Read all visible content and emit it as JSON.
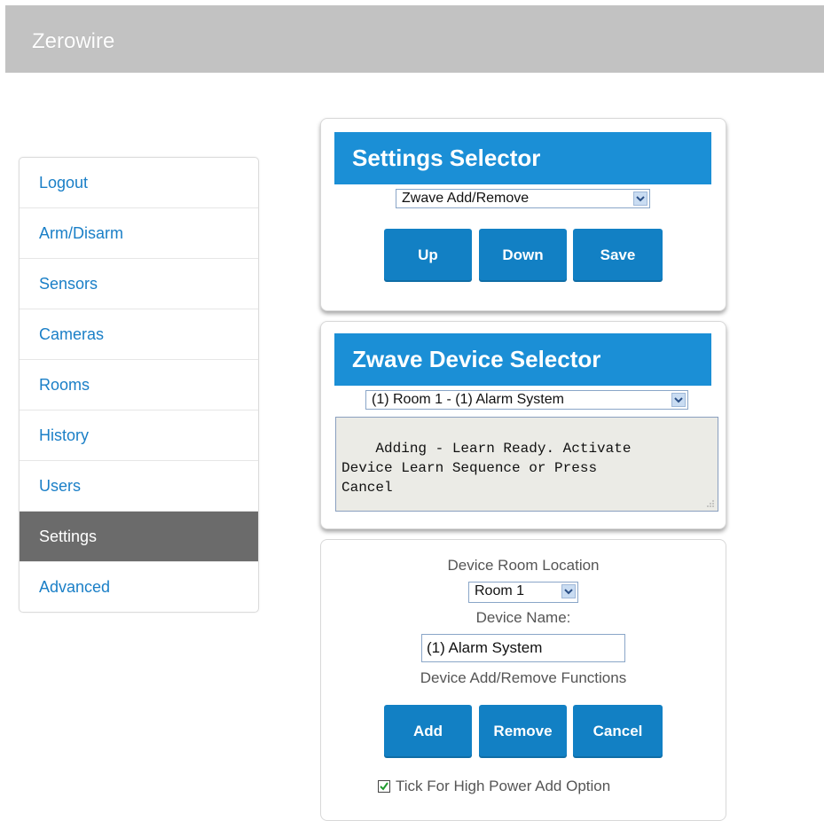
{
  "app": {
    "title": "Zerowire"
  },
  "sidebar": {
    "items": [
      {
        "label": "Logout"
      },
      {
        "label": "Arm/Disarm"
      },
      {
        "label": "Sensors"
      },
      {
        "label": "Cameras"
      },
      {
        "label": "Rooms"
      },
      {
        "label": "History"
      },
      {
        "label": "Users"
      },
      {
        "label": "Settings",
        "active": true
      },
      {
        "label": "Advanced"
      }
    ]
  },
  "settings_selector": {
    "title": "Settings Selector",
    "selected": "Zwave Add/Remove",
    "buttons": {
      "up": "Up",
      "down": "Down",
      "save": "Save"
    }
  },
  "device_selector": {
    "title": "Zwave Device Selector",
    "selected": "(1) Room 1 - (1) Alarm System",
    "status_text": "Adding - Learn Ready. Activate\nDevice Learn Sequence or Press\nCancel"
  },
  "device_panel": {
    "room_location_label": "Device Room Location",
    "room_selected": "Room 1",
    "name_label": "Device Name:",
    "name_value": "(1) Alarm System",
    "functions_label": "Device Add/Remove Functions",
    "buttons": {
      "add": "Add",
      "remove": "Remove",
      "cancel": "Cancel"
    },
    "high_power_label": "Tick For High Power Add Option",
    "high_power_checked": true
  },
  "colors": {
    "header_blue": "#1b8fd6",
    "button_blue": "#1280c4",
    "link_blue": "#1a7fc7",
    "active_nav": "#6b6b6b",
    "topbar": "#c2c2c2"
  },
  "icons": {
    "dropdown": "chevron-down-icon",
    "checkbox": "checkmark-icon",
    "resize": "resize-grip-icon"
  }
}
